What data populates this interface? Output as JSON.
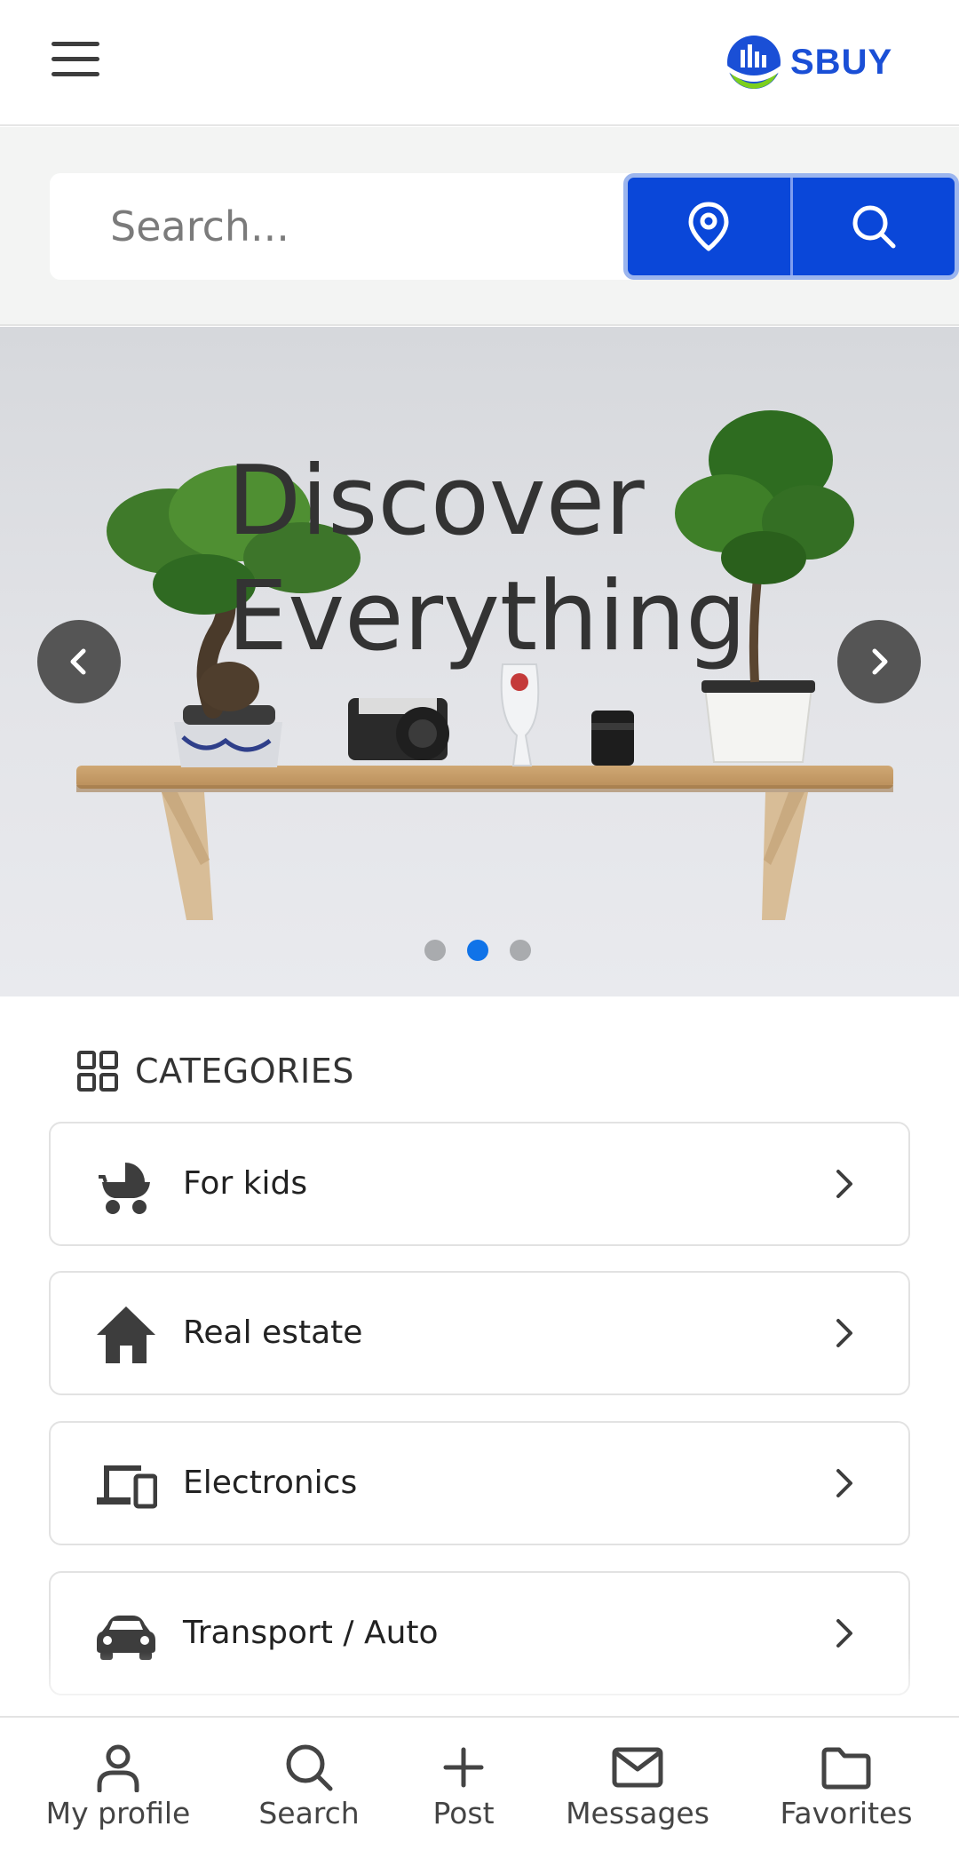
{
  "header": {
    "menu_icon": "hamburger-icon",
    "logo_text": "SBUY",
    "colors": {
      "logo_blue": "#1a4fd6",
      "logo_green": "#7ccf1e"
    }
  },
  "search": {
    "placeholder": "Search...",
    "location_icon": "location-pin-icon",
    "search_icon": "search-icon",
    "button_color": "#0a47d9"
  },
  "hero": {
    "headline_line1": "Discover",
    "headline_line2": "Everything",
    "slides_count": 3,
    "active_slide": 2,
    "prev_icon": "chevron-left-icon",
    "next_icon": "chevron-right-icon",
    "active_dot_color": "#1073e8"
  },
  "categories": {
    "title": "CATEGORIES",
    "title_icon": "grid-icon",
    "items": [
      {
        "label": "For kids",
        "icon": "stroller-icon"
      },
      {
        "label": "Real estate",
        "icon": "house-icon"
      },
      {
        "label": "Electronics",
        "icon": "devices-icon"
      },
      {
        "label": "Transport / Auto",
        "icon": "car-icon"
      }
    ]
  },
  "bottom_nav": {
    "items": [
      {
        "label": "My profile",
        "icon": "user-icon"
      },
      {
        "label": "Search",
        "icon": "search-icon"
      },
      {
        "label": "Post",
        "icon": "plus-icon"
      },
      {
        "label": "Messages",
        "icon": "envelope-icon"
      },
      {
        "label": "Favorites",
        "icon": "folder-icon"
      }
    ]
  }
}
